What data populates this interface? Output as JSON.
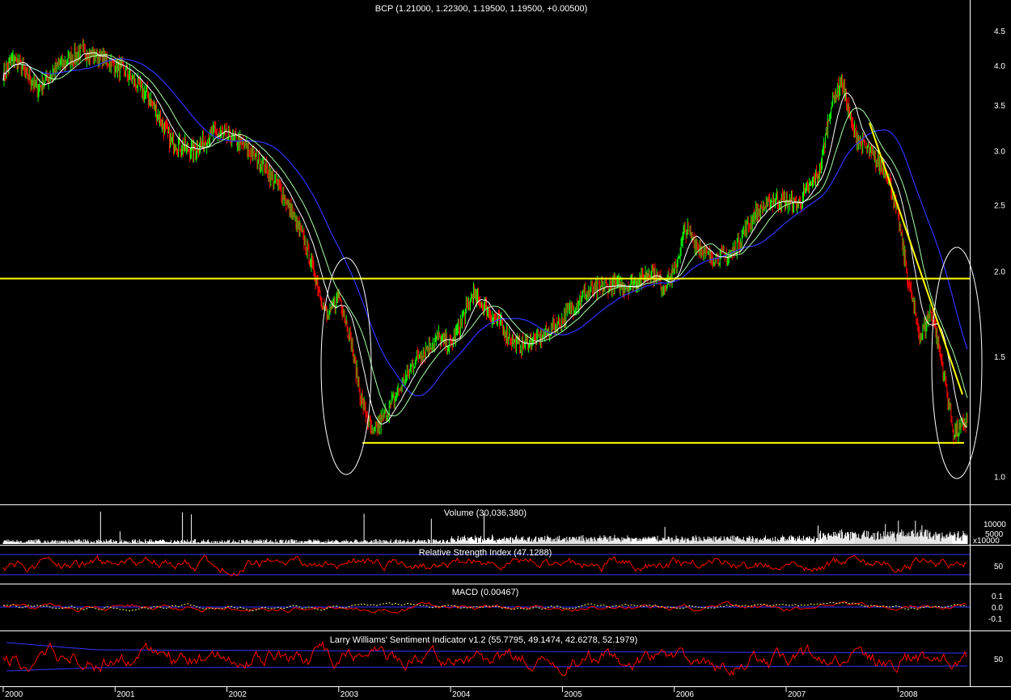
{
  "colors": {
    "background": "#000000",
    "frame": "#ffffff",
    "candle_up": "#00ff00",
    "candle_down": "#ff0000",
    "ma_fast": "#ffffff",
    "ma_mid": "#a8ffa8",
    "ma_slow": "#3333ff",
    "support": "#ffff00",
    "oscillator": "#ff0000",
    "signal": "#ffff66",
    "band": "#3333ff"
  },
  "chart_data": [
    {
      "panel": "price",
      "type": "line",
      "title": "BCP (1.21000, 1.22300, 1.19500, 1.19500, +0.00500)",
      "scale": "log",
      "ylim": [
        0.92,
        4.7
      ],
      "yticks": [
        "4.5",
        "4.0",
        "3.5",
        "3.0",
        "2.5",
        "2.0",
        "1.5",
        "1.0"
      ],
      "ytick_values": [
        4.5,
        4.0,
        3.5,
        3.0,
        2.5,
        2.0,
        1.5,
        1.0
      ],
      "x": [
        2000.0,
        2000.1,
        2000.3,
        2000.5,
        2000.7,
        2000.9,
        2001.1,
        2001.3,
        2001.5,
        2001.7,
        2001.9,
        2002.1,
        2002.3,
        2002.5,
        2002.7,
        2002.9,
        2003.0,
        2003.1,
        2003.2,
        2003.3,
        2003.5,
        2003.7,
        2003.9,
        2004.0,
        2004.2,
        2004.4,
        2004.6,
        2004.8,
        2005.0,
        2005.2,
        2005.4,
        2005.6,
        2005.8,
        2005.9,
        2006.0,
        2006.1,
        2006.3,
        2006.5,
        2006.7,
        2006.9,
        2007.1,
        2007.3,
        2007.4,
        2007.5,
        2007.6,
        2007.8,
        2007.9,
        2008.0,
        2008.1,
        2008.2,
        2008.3,
        2008.4,
        2008.5,
        2008.6
      ],
      "series": [
        {
          "values": [
            3.9,
            4.1,
            3.7,
            4.0,
            4.2,
            4.1,
            3.9,
            3.6,
            3.1,
            3.0,
            3.2,
            3.1,
            2.9,
            2.6,
            2.2,
            1.7,
            1.85,
            1.6,
            1.3,
            1.15,
            1.3,
            1.5,
            1.6,
            1.55,
            1.85,
            1.7,
            1.55,
            1.6,
            1.7,
            1.85,
            1.9,
            1.9,
            2.0,
            1.9,
            2.0,
            2.3,
            2.1,
            2.1,
            2.4,
            2.55,
            2.5,
            2.8,
            3.5,
            3.8,
            3.2,
            2.9,
            2.8,
            2.4,
            1.9,
            1.6,
            1.75,
            1.45,
            1.15,
            1.2
          ]
        }
      ],
      "support_levels": [
        1.95,
        1.12
      ],
      "x_labels": [
        "2000",
        "2001",
        "2002",
        "2003",
        "2004",
        "2005",
        "2006",
        "2007",
        "2008"
      ]
    },
    {
      "panel": "volume",
      "type": "bar",
      "title": "Volume (30,036,380)",
      "yticks": [
        "10000",
        "5000",
        "x10000"
      ]
    },
    {
      "panel": "rsi",
      "type": "line",
      "title": "Relative Strength Index (47.1288)",
      "ylim": [
        0,
        100
      ],
      "yticks": [
        "50"
      ],
      "bands": [
        30,
        70
      ]
    },
    {
      "panel": "macd",
      "type": "line",
      "title": "MACD (0.00467)",
      "ylim": [
        -0.22,
        0.22
      ],
      "yticks": [
        "0.1",
        "0.0",
        "-0.1"
      ]
    },
    {
      "panel": "sentiment",
      "type": "line",
      "title": "Larry Williams' Sentiment Indicator v1.2 (55.7795, 49.1474, 42.6278, 52.1979)",
      "ylim": [
        0,
        100
      ],
      "yticks": [
        "50"
      ]
    }
  ]
}
